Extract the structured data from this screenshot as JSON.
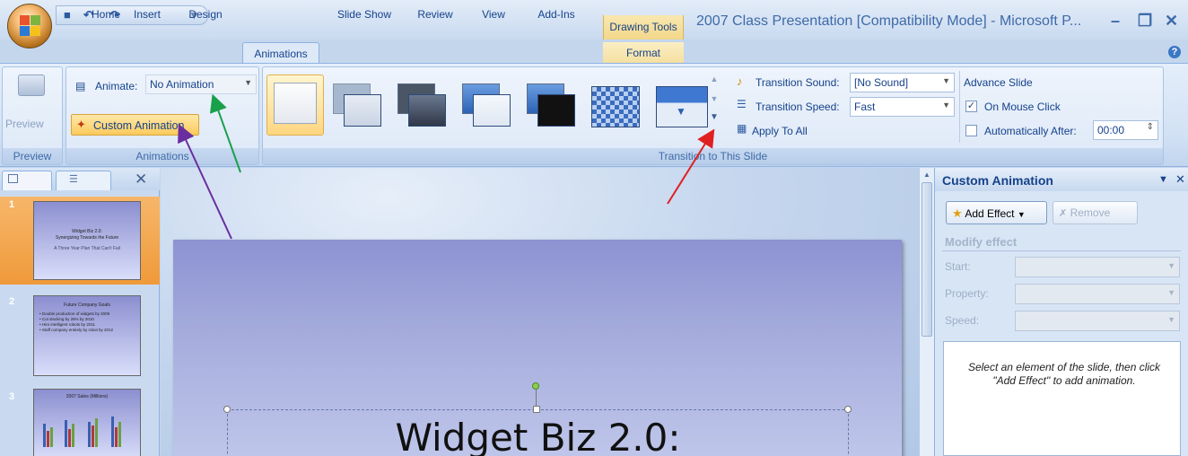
{
  "qat": {
    "save": "■",
    "undo": "↶",
    "redo": "↷"
  },
  "title_bar": {
    "context_tools": "Drawing Tools",
    "document_title": "2007 Class Presentation [Compatibility Mode] - Microsoft P...",
    "minimize": "–",
    "restore": "❐",
    "close": "✕"
  },
  "tabs": [
    "Home",
    "Insert",
    "Design",
    "Animations",
    "Slide Show",
    "Review",
    "View",
    "Add-Ins",
    "Format"
  ],
  "active_tab": "Animations",
  "help": "?",
  "ribbon": {
    "preview_group": {
      "button": "Preview",
      "label": "Preview"
    },
    "animations_group": {
      "animate_label": "Animate:",
      "animate_value": "No Animation",
      "custom_animation": "Custom Animation",
      "label": "Animations"
    },
    "transition_group": {
      "sound_label": "Transition Sound:",
      "sound_value": "[No Sound]",
      "speed_label": "Transition Speed:",
      "speed_value": "Fast",
      "apply_all": "Apply To All",
      "label": "Transition to This Slide"
    },
    "advance_group": {
      "title": "Advance Slide",
      "on_click": "On Mouse Click",
      "on_click_checked": true,
      "auto_after": "Automatically After:",
      "auto_after_value": "00:00",
      "auto_after_checked": false
    }
  },
  "slides_panel": {
    "close": "✕",
    "slides": [
      {
        "num": "1",
        "title": "Widget Biz 2.0:",
        "subtitle": "Synergizing Towards the Future",
        "line": "A Three Year Plan That Can't Fail"
      },
      {
        "num": "2",
        "title": "Future Company Goals",
        "bullets": [
          "Double production of widgets by 2009",
          "Cut slacking by 28% by 2010",
          "Hire intelligent robots by 2011",
          "Staff company entirely by robot by 2012"
        ]
      },
      {
        "num": "3",
        "title": "2007 Sales (Millions)"
      }
    ]
  },
  "slide": {
    "title": "Widget Biz 2.0:"
  },
  "task_pane": {
    "title": "Custom Animation",
    "add_effect": "Add Effect",
    "remove": "Remove",
    "modify_effect": "Modify effect",
    "start_label": "Start:",
    "property_label": "Property:",
    "speed_label": "Speed:",
    "hint": "Select an element of the slide, then click \"Add Effect\" to add animation."
  },
  "colors": {
    "accent": "#15428b",
    "ribbon": "#dde9f7",
    "arrow_green": "#1aa04b",
    "arrow_purple": "#6a2ea0",
    "arrow_red": "#e02020"
  }
}
